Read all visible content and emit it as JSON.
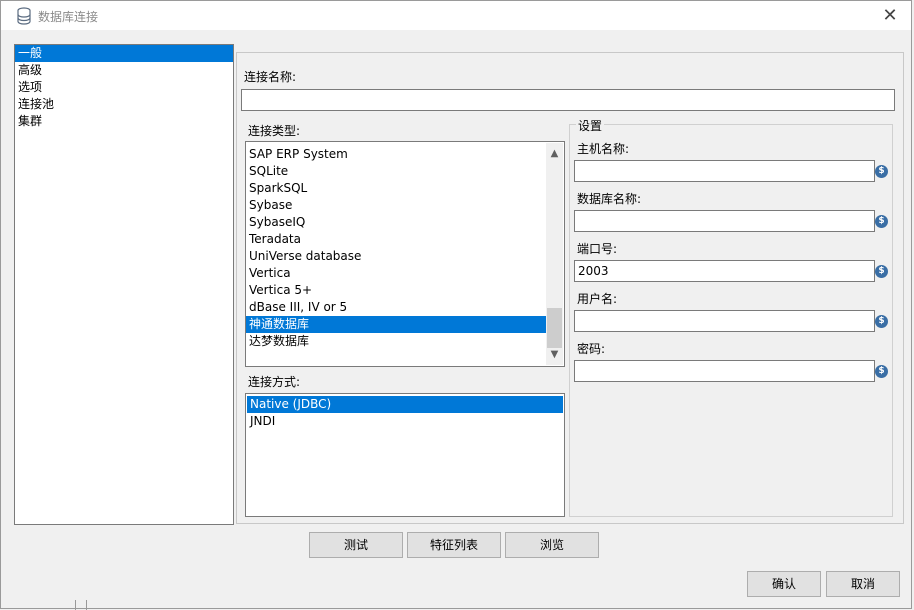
{
  "window": {
    "title": "数据库连接",
    "icon": "database-icon",
    "close_glyph": "✕"
  },
  "sidebar": {
    "items": [
      {
        "label": "一般",
        "selected": true
      },
      {
        "label": "高级",
        "selected": false
      },
      {
        "label": "选项",
        "selected": false
      },
      {
        "label": "连接池",
        "selected": false
      },
      {
        "label": "集群",
        "selected": false
      }
    ]
  },
  "general": {
    "connection_name_label": "连接名称:",
    "connection_name_value": "",
    "connection_type_label": "连接类型:",
    "connection_types": [
      {
        "label": "SAP ERP System",
        "selected": false
      },
      {
        "label": "SQLite",
        "selected": false
      },
      {
        "label": "SparkSQL",
        "selected": false
      },
      {
        "label": "Sybase",
        "selected": false
      },
      {
        "label": "SybaseIQ",
        "selected": false
      },
      {
        "label": "Teradata",
        "selected": false
      },
      {
        "label": "UniVerse database",
        "selected": false
      },
      {
        "label": "Vertica",
        "selected": false
      },
      {
        "label": "Vertica 5+",
        "selected": false
      },
      {
        "label": "dBase III, IV or 5",
        "selected": false
      },
      {
        "label": "神通数据库",
        "selected": true
      },
      {
        "label": "达梦数据库",
        "selected": false
      }
    ],
    "access_label": "连接方式:",
    "access_methods": [
      {
        "label": "Native (JDBC)",
        "selected": true
      },
      {
        "label": "JNDI",
        "selected": false
      }
    ]
  },
  "settings": {
    "legend": "设置",
    "fields": [
      {
        "label": "主机名称:",
        "value": ""
      },
      {
        "label": "数据库名称:",
        "value": ""
      },
      {
        "label": "端口号:",
        "value": "2003"
      },
      {
        "label": "用户名:",
        "value": ""
      },
      {
        "label": "密码:",
        "value": ""
      }
    ],
    "variable_icon_glyph": "$"
  },
  "buttons": {
    "test": "测试",
    "feature_list": "特征列表",
    "explore": "浏览",
    "ok": "确认",
    "cancel": "取消"
  },
  "colors": {
    "selection": "#0078d7",
    "variable_icon": "#3a6ea5"
  }
}
